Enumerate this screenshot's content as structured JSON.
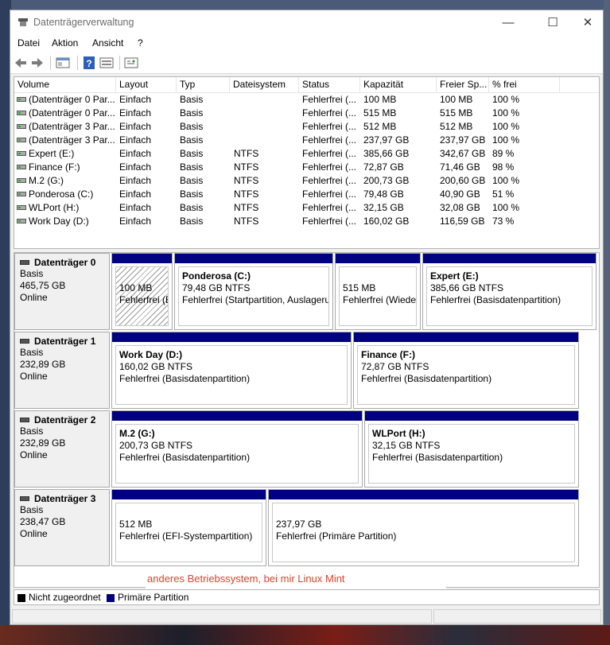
{
  "window": {
    "title": "Datenträgerverwaltung"
  },
  "menu": {
    "items": [
      "Datei",
      "Aktion",
      "Ansicht",
      "?"
    ]
  },
  "toolbar": {
    "buttons": [
      "back-icon",
      "forward-icon",
      "properties-icon",
      "help-icon",
      "view-icon",
      "settings-icon"
    ]
  },
  "list": {
    "headers": [
      "Volume",
      "Layout",
      "Typ",
      "Dateisystem",
      "Status",
      "Kapazität",
      "Freier Sp...",
      "% frei"
    ],
    "rows": [
      [
        "(Datenträger 0 Par...",
        "Einfach",
        "Basis",
        "",
        "Fehlerfrei (...",
        "100 MB",
        "100 MB",
        "100 %"
      ],
      [
        "(Datenträger 0 Par...",
        "Einfach",
        "Basis",
        "",
        "Fehlerfrei (...",
        "515 MB",
        "515 MB",
        "100 %"
      ],
      [
        "(Datenträger 3 Par...",
        "Einfach",
        "Basis",
        "",
        "Fehlerfrei (...",
        "512 MB",
        "512 MB",
        "100 %"
      ],
      [
        "(Datenträger 3 Par...",
        "Einfach",
        "Basis",
        "",
        "Fehlerfrei (...",
        "237,97 GB",
        "237,97 GB",
        "100 %"
      ],
      [
        "Expert (E:)",
        "Einfach",
        "Basis",
        "NTFS",
        "Fehlerfrei (...",
        "385,66 GB",
        "342,67 GB",
        "89 %"
      ],
      [
        "Finance (F:)",
        "Einfach",
        "Basis",
        "NTFS",
        "Fehlerfrei (...",
        "72,87 GB",
        "71,46 GB",
        "98 %"
      ],
      [
        "M.2 (G:)",
        "Einfach",
        "Basis",
        "NTFS",
        "Fehlerfrei (...",
        "200,73 GB",
        "200,60 GB",
        "100 %"
      ],
      [
        "Ponderosa (C:)",
        "Einfach",
        "Basis",
        "NTFS",
        "Fehlerfrei (...",
        "79,48 GB",
        "40,90 GB",
        "51 %"
      ],
      [
        "WLPort (H:)",
        "Einfach",
        "Basis",
        "NTFS",
        "Fehlerfrei (...",
        "32,15 GB",
        "32,08 GB",
        "100 %"
      ],
      [
        "Work Day (D:)",
        "Einfach",
        "Basis",
        "NTFS",
        "Fehlerfrei (...",
        "160,02 GB",
        "116,59 GB",
        "73 %"
      ]
    ]
  },
  "disks": [
    {
      "name": "Datenträger 0",
      "type": "Basis",
      "size": "465,75 GB",
      "state": "Online",
      "partitions": [
        {
          "name": "",
          "size": "100 MB",
          "status": "Fehlerfrei (EFI",
          "hatched": true
        },
        {
          "name": "Ponderosa  (C:)",
          "size": "79,48 GB NTFS",
          "status": "Fehlerfrei (Startpartition, Auslageru"
        },
        {
          "name": "",
          "size": "515 MB",
          "status": "Fehlerfrei (Wieder"
        },
        {
          "name": "Expert  (E:)",
          "size": "385,66 GB NTFS",
          "status": "Fehlerfrei (Basisdatenpartition)"
        }
      ]
    },
    {
      "name": "Datenträger 1",
      "type": "Basis",
      "size": "232,89 GB",
      "state": "Online",
      "partitions": [
        {
          "name": "Work Day  (D:)",
          "size": "160,02 GB NTFS",
          "status": "Fehlerfrei (Basisdatenpartition)"
        },
        {
          "name": "Finance  (F:)",
          "size": "72,87 GB NTFS",
          "status": "Fehlerfrei (Basisdatenpartition)"
        }
      ]
    },
    {
      "name": "Datenträger 2",
      "type": "Basis",
      "size": "232,89 GB",
      "state": "Online",
      "partitions": [
        {
          "name": "M.2  (G:)",
          "size": "200,73 GB NTFS",
          "status": "Fehlerfrei (Basisdatenpartition)"
        },
        {
          "name": "WLPort  (H:)",
          "size": "32,15 GB NTFS",
          "status": "Fehlerfrei (Basisdatenpartition)"
        }
      ]
    },
    {
      "name": "Datenträger 3",
      "type": "Basis",
      "size": "238,47 GB",
      "state": "Online",
      "partitions": [
        {
          "name": "",
          "size": "512 MB",
          "status": "Fehlerfrei (EFI-Systempartition)"
        },
        {
          "name": "",
          "size": "237,97 GB",
          "status": "Fehlerfrei (Primäre Partition)"
        }
      ]
    }
  ],
  "annotation": "anderes Betriebssystem, bei mir Linux Mint",
  "legend": {
    "unallocated": "Nicht zugeordnet",
    "primary": "Primäre Partition",
    "unallocated_color": "#000000",
    "primary_color": "#000082"
  }
}
